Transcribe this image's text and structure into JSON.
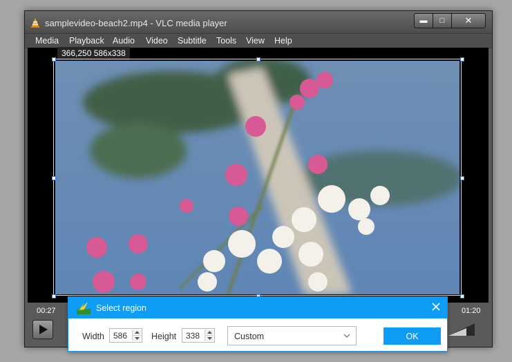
{
  "window": {
    "title": "samplevideo-beach2.mp4 - VLC media player",
    "controls": {
      "minimize": "▬",
      "maximize": "□",
      "close": "✕"
    }
  },
  "menu": [
    "Media",
    "Playback",
    "Audio",
    "Video",
    "Subtitle",
    "Tools",
    "View",
    "Help"
  ],
  "selection": {
    "label": "366,250 586x338"
  },
  "player": {
    "elapsed": "00:27",
    "duration": "01:20"
  },
  "dialog": {
    "title": "Select region",
    "width_label": "Width",
    "width_value": "586",
    "height_label": "Height",
    "height_value": "338",
    "preset_value": "Custom",
    "ok_label": "OK"
  },
  "colors": {
    "accent": "#0e9cf5",
    "selection_border": "#cde2ff"
  },
  "icons": [
    "vlc-cone-icon",
    "minimize-icon",
    "maximize-icon",
    "close-icon",
    "play-icon",
    "volume-icon",
    "region-capture-icon",
    "dialog-close-icon",
    "spin-up-icon",
    "spin-down-icon",
    "chevron-down-icon"
  ]
}
